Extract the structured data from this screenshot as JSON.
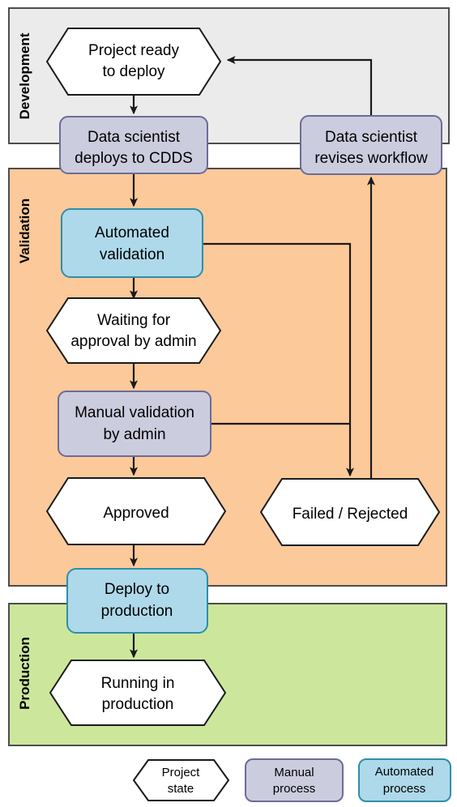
{
  "diagram": {
    "title": "Deployment workflow swimlane flowchart",
    "lanes": [
      {
        "id": "development",
        "label": "Development",
        "color": "#ebebeb"
      },
      {
        "id": "validation",
        "label": "Validation",
        "color": "#fcc99a"
      },
      {
        "id": "production",
        "label": "Production",
        "color": "#cce79b"
      }
    ],
    "nodes": [
      {
        "id": "project-ready",
        "label": "Project ready to deploy",
        "line1": "Project ready",
        "line2": "to deploy",
        "type": "project-state",
        "lane": "development"
      },
      {
        "id": "deploys-to-cdds",
        "label": "Data scientist deploys to CDDS",
        "line1": "Data scientist",
        "line2": "deploys to CDDS",
        "type": "manual-process",
        "lane": "development"
      },
      {
        "id": "revises-workflow",
        "label": "Data scientist revises workflow",
        "line1": "Data scientist",
        "line2": "revises workflow",
        "type": "manual-process",
        "lane": "development"
      },
      {
        "id": "automated-validation",
        "label": "Automated validation",
        "line1": "Automated",
        "line2": "validation",
        "type": "automated-process",
        "lane": "validation"
      },
      {
        "id": "waiting-for-approval",
        "label": "Waiting for approval by admin",
        "line1": "Waiting for",
        "line2": "approval by admin",
        "type": "project-state",
        "lane": "validation"
      },
      {
        "id": "manual-validation",
        "label": "Manual validation by admin",
        "line1": "Manual validation",
        "line2": "by admin",
        "type": "manual-process",
        "lane": "validation"
      },
      {
        "id": "approved",
        "label": "Approved",
        "line1": "Approved",
        "line2": "",
        "type": "project-state",
        "lane": "validation"
      },
      {
        "id": "failed-rejected",
        "label": "Failed / Rejected",
        "line1": "Failed / Rejected",
        "line2": "",
        "type": "project-state",
        "lane": "validation"
      },
      {
        "id": "deploy-to-production",
        "label": "Deploy to production",
        "line1": "Deploy to",
        "line2": "production",
        "type": "automated-process",
        "lane": "production"
      },
      {
        "id": "running-in-production",
        "label": "Running in production",
        "line1": "Running in",
        "line2": "production",
        "type": "project-state",
        "lane": "production"
      }
    ],
    "edges": [
      {
        "id": "edge-ready-to-deploys",
        "from": "project-ready",
        "to": "deploys-to-cdds"
      },
      {
        "id": "edge-deploys-to-autoval",
        "from": "deploys-to-cdds",
        "to": "automated-validation"
      },
      {
        "id": "edge-autoval-to-waiting",
        "from": "automated-validation",
        "to": "waiting-for-approval"
      },
      {
        "id": "edge-autoval-to-failed",
        "from": "automated-validation",
        "to": "failed-rejected"
      },
      {
        "id": "edge-waiting-to-manualval",
        "from": "waiting-for-approval",
        "to": "manual-validation"
      },
      {
        "id": "edge-manualval-to-approved",
        "from": "manual-validation",
        "to": "approved"
      },
      {
        "id": "edge-manualval-to-failed",
        "from": "manual-validation",
        "to": "failed-rejected"
      },
      {
        "id": "edge-approved-to-deploy",
        "from": "approved",
        "to": "deploy-to-production"
      },
      {
        "id": "edge-deploy-to-running",
        "from": "deploy-to-production",
        "to": "running-in-production"
      },
      {
        "id": "edge-failed-to-revises",
        "from": "failed-rejected",
        "to": "revises-workflow"
      },
      {
        "id": "edge-revises-to-ready",
        "from": "revises-workflow",
        "to": "project-ready"
      }
    ],
    "legend": [
      {
        "id": "legend-project-state",
        "line1": "Project",
        "line2": "state",
        "type": "project-state"
      },
      {
        "id": "legend-manual-process",
        "line1": "Manual",
        "line2": "process",
        "type": "manual-process"
      },
      {
        "id": "legend-automated-process",
        "line1": "Automated",
        "line2": "process",
        "type": "automated-process"
      }
    ],
    "colors": {
      "development_lane": "#ebebeb",
      "validation_lane": "#fcc99a",
      "production_lane": "#cce79b",
      "manual_fill": "#ccccdf",
      "manual_stroke": "#6c6c99",
      "automated_fill": "#aed9ea",
      "automated_stroke": "#2e8fa8",
      "state_fill": "#ffffff",
      "state_stroke": "#1a1a1a"
    }
  }
}
